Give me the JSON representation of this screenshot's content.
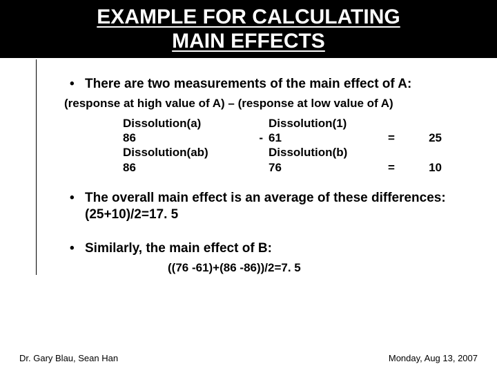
{
  "title_line1": "EXAMPLE FOR CALCULATING",
  "title_line2": "MAIN EFFECTS",
  "bullet1": "There are two measurements of the main effect of A:",
  "formula_header": "(response at high value of A) – (response at low value of A)",
  "rows": [
    {
      "left_label": "Dissolution(a)",
      "left_val": "86",
      "op": "-",
      "right_label": "Dissolution(1)",
      "right_val": "61",
      "eq": "=",
      "result": "25"
    },
    {
      "left_label": "Dissolution(ab)",
      "left_val": "86",
      "op": "",
      "right_label": "Dissolution(b)",
      "right_val": " 76",
      "eq": "=",
      "result": "10"
    }
  ],
  "bullet2_pre": "The overall main effect is an average of these differences:  ",
  "bullet2_calc": "(25+10)/2=17. 5",
  "bullet3": "Similarly, the main effect of B:",
  "bullet3_calc": "((76 -61)+(86 -86))/2=7. 5",
  "footer_left": "Dr. Gary Blau, Sean Han",
  "footer_right": "Monday, Aug 13, 2007"
}
